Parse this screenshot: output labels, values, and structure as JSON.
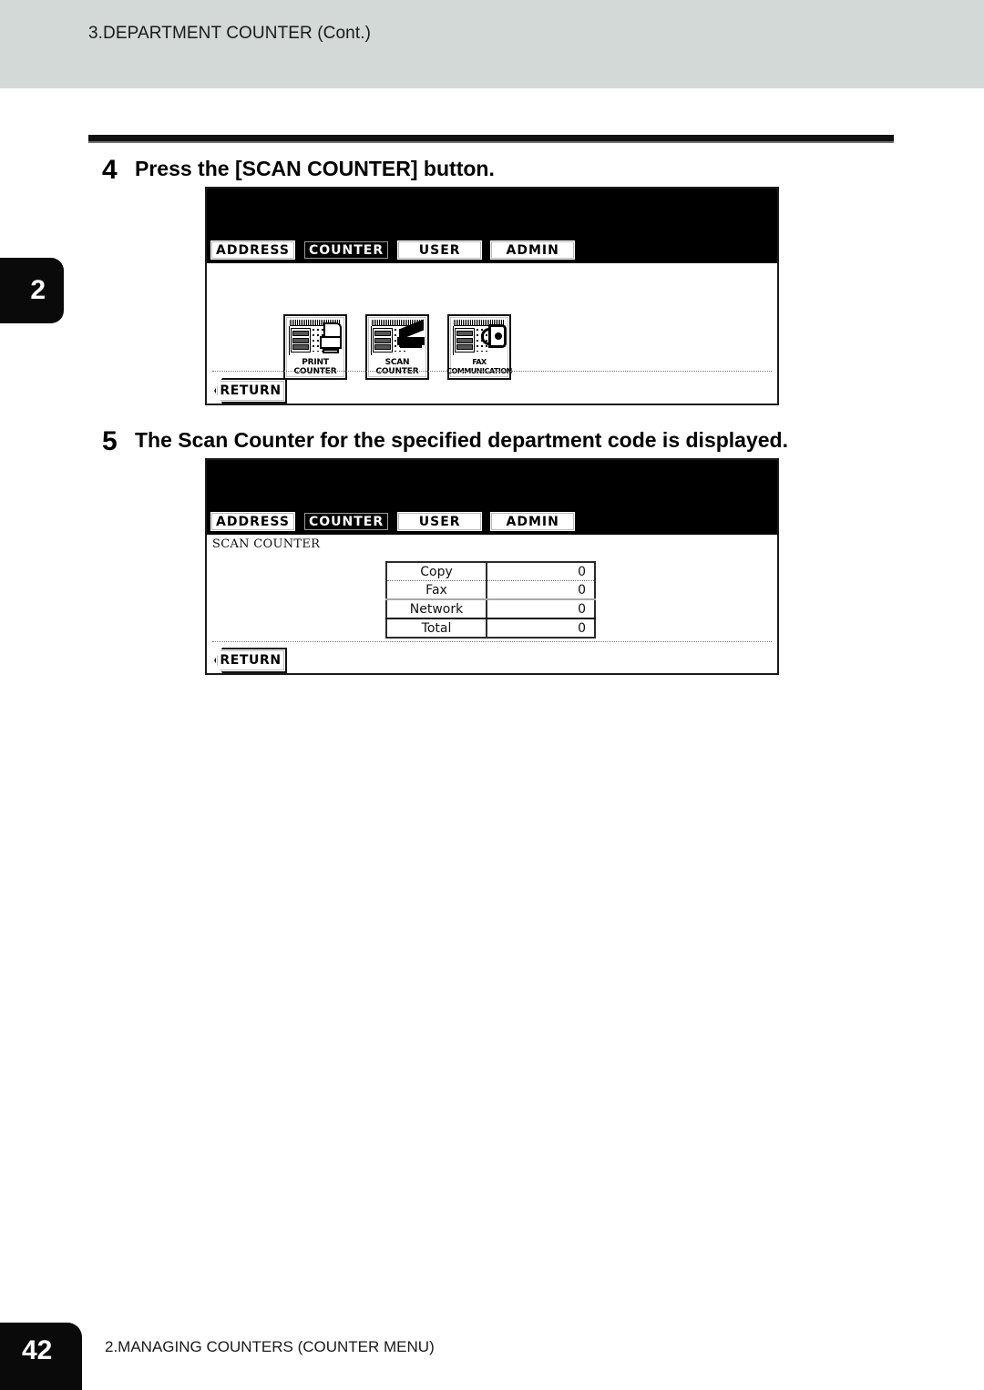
{
  "page": {
    "running_header": "3.DEPARTMENT COUNTER (Cont.)",
    "chapter_tab": "2",
    "page_number": "42",
    "footer_title": "2.MANAGING COUNTERS (COUNTER MENU)"
  },
  "steps": [
    {
      "number": "4",
      "text": "Press the [SCAN COUNTER] button.",
      "screen": {
        "tabs": [
          {
            "label": "ADDRESS",
            "selected": false
          },
          {
            "label": "COUNTER",
            "selected": true
          },
          {
            "label": "USER",
            "selected": false
          },
          {
            "label": "ADMIN",
            "selected": false
          }
        ],
        "buttons": [
          {
            "label": "PRINT\nCOUNTER",
            "icon": "print-counter-icon"
          },
          {
            "label": "SCAN\nCOUNTER",
            "icon": "scan-counter-icon"
          },
          {
            "label": "FAX\nCOMMUNICATION",
            "icon": "fax-communication-icon"
          }
        ],
        "return_label": "RETURN"
      }
    },
    {
      "number": "5",
      "text": "The Scan Counter for the specified department code is displayed.",
      "screen": {
        "tabs": [
          {
            "label": "ADDRESS",
            "selected": false
          },
          {
            "label": "COUNTER",
            "selected": true
          },
          {
            "label": "USER",
            "selected": false
          },
          {
            "label": "ADMIN",
            "selected": false
          }
        ],
        "caption": "SCAN COUNTER",
        "table": {
          "rows": [
            {
              "label": "Copy",
              "value": "0"
            },
            {
              "label": "Fax",
              "value": "0"
            },
            {
              "label": "Network",
              "value": "0"
            },
            {
              "label": "Total",
              "value": "0"
            }
          ]
        },
        "return_label": "RETURN"
      }
    }
  ],
  "colors": {
    "header_band": "#d2d9d7",
    "ink": "#000000",
    "lcd_top": "#000000"
  }
}
